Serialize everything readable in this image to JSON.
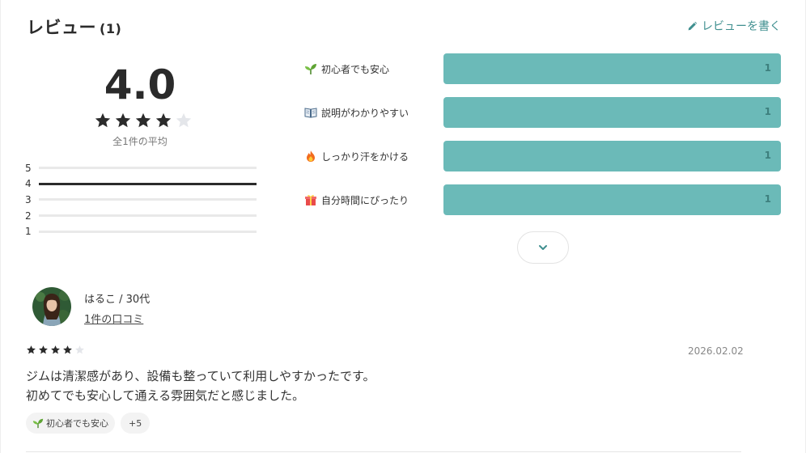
{
  "header": {
    "title": "レビュー",
    "count": "(1)",
    "write_label": "レビューを書く",
    "accent": "#3f8f8f"
  },
  "summary": {
    "average": "4.0",
    "rating": 4,
    "max_rating": 5,
    "note": "全1件の平均",
    "distribution": [
      {
        "label": "5",
        "count": 0
      },
      {
        "label": "4",
        "count": 1
      },
      {
        "label": "3",
        "count": 0
      },
      {
        "label": "2",
        "count": 0
      },
      {
        "label": "1",
        "count": 0
      }
    ]
  },
  "tags": [
    {
      "icon": "sprout-icon",
      "label": "初心者でも安心",
      "count": "1"
    },
    {
      "icon": "open-book-icon",
      "label": "説明がわかりやすい",
      "count": "1"
    },
    {
      "icon": "fire-icon",
      "label": "しっかり汗をかける",
      "count": "1"
    },
    {
      "icon": "gift-icon",
      "label": "自分時間にぴったり",
      "count": "1"
    }
  ],
  "tag_bar_color": "#6bbab8",
  "review": {
    "user": "はるこ / 30代",
    "user_link": "1件の口コミ",
    "rating": 4,
    "date": "2026.02.02",
    "text_line1": "ジムは清潔感があり、設備も整っていて利用しやすかったです。",
    "text_line2": "初めてでも安心して通える雰囲気だと感じました。",
    "chips": [
      {
        "icon": "sprout-icon",
        "label": "初心者でも安心"
      },
      {
        "label": "+5"
      }
    ]
  }
}
